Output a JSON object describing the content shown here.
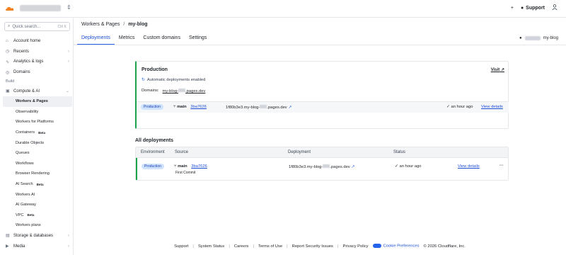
{
  "topbar": {
    "plus_icon": "plus-icon",
    "support_label": "Support",
    "support_icon": "help-circle-icon",
    "user_icon": "user-icon"
  },
  "sidebar": {
    "search_placeholder": "Quick search...",
    "search_shortcut": "Ctrl K",
    "items": [
      {
        "label": "Account home",
        "icon": "home-icon"
      },
      {
        "label": "Recents",
        "icon": "clock-icon",
        "chevron": true
      },
      {
        "label": "Analytics & logs",
        "icon": "chart-icon",
        "chevron": true
      },
      {
        "label": "Domains",
        "icon": "globe-icon"
      }
    ],
    "section_build": "Build",
    "compute_label": "Compute & AI",
    "compute_items": [
      {
        "label": "Workers & Pages",
        "active": true
      },
      {
        "label": "Observability"
      },
      {
        "label": "Workers for Platforms"
      },
      {
        "label": "Containers",
        "badge": "Beta"
      },
      {
        "label": "Durable Objects"
      },
      {
        "label": "Queues"
      },
      {
        "label": "Workflows"
      },
      {
        "label": "Browser Rendering"
      },
      {
        "label": "AI Search",
        "badge": "Beta"
      },
      {
        "label": "Workers AI"
      },
      {
        "label": "AI Gateway"
      },
      {
        "label": "VPC",
        "badge": "Beta"
      },
      {
        "label": "Workers plans"
      }
    ],
    "storage_label": "Storage & databases",
    "media_label": "Media"
  },
  "main": {
    "breadcrumb_parent": "Workers & Pages",
    "breadcrumb_sep": "/",
    "breadcrumb_current": "my-blog",
    "tabs": [
      "Deployments",
      "Metrics",
      "Custom domains",
      "Settings"
    ],
    "repo_name": "my-blog",
    "production": {
      "title": "Production",
      "visit_label": "Visit",
      "auto_deploy_text": "Automatic deployments enabled",
      "domains_label": "Domains:",
      "domain_a": "my-blog-",
      "domain_b": ".pages.dev",
      "env_pill": "Production",
      "branch": "main",
      "commit": "3ba7626",
      "deployment_url_a": "1f80b3e3.my-blog-",
      "deployment_url_b": ".pages.dev",
      "time": "an hour ago",
      "details_label": "View details"
    },
    "all_deployments": {
      "title": "All deployments",
      "headers": [
        "Environment",
        "Source",
        "Deployment",
        "Status"
      ],
      "rows": [
        {
          "env": "Production",
          "branch": "main",
          "commit": "3ba7626",
          "message": "First Commit",
          "url_a": "1f80b3e3.my-blog-",
          "url_b": ".pages.dev",
          "status": "an hour ago",
          "details": "View details",
          "menu": "···"
        }
      ]
    }
  },
  "footer": {
    "links": [
      "Support",
      "System Status",
      "Careers",
      "Terms of Use",
      "Report Security Issues",
      "Privacy Policy"
    ],
    "cookie_label": "Cookie Preferences",
    "copyright": "© 2026 Cloudflare, Inc."
  },
  "colors": {
    "accent": "#2563eb",
    "success": "#16a34a",
    "brand_orange": "#f48120"
  }
}
